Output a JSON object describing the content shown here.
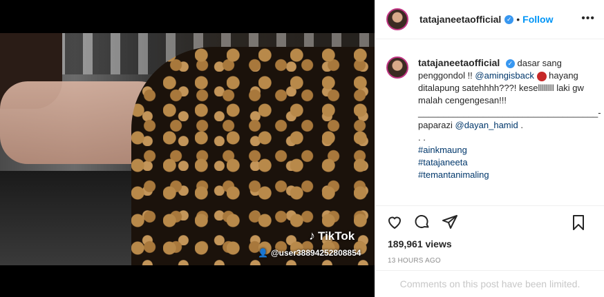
{
  "post": {
    "username": "tatajaneetaofficial",
    "follow_label": "Follow",
    "more_label": "•••",
    "views": "189,961 views",
    "time_ago": "13 HOURS AGO",
    "comments_limited": "Comments on this post have been limited."
  },
  "caption": {
    "username": "tatajaneetaofficial",
    "text_1": "dasar sang penggondol !!",
    "mention_1": "@amingisback",
    "text_2": "hayang ditalapung satehhhh???! kesellllllll laki gw malah cengengesan!!!",
    "divider": "____________________________________-",
    "paparazi_label": "paparazi",
    "mention_2": "@dayan_hamid",
    "paparazi_end": ".",
    "dots": ". .",
    "hashtags": [
      "#ainkmaung",
      "#tatajaneeta",
      "#temantanimaling"
    ]
  },
  "video": {
    "watermark": "TikTok",
    "user": "@user38894252808854"
  },
  "icons": [
    "verified-icon",
    "heart-icon",
    "comment-icon",
    "share-icon",
    "bookmark-icon",
    "tiktok-logo-icon",
    "angry-emoji-icon"
  ],
  "colors": {
    "follow": "#0095f6",
    "link": "#00376b",
    "verified": "#3897f0",
    "muted": "#8e8e8e"
  }
}
